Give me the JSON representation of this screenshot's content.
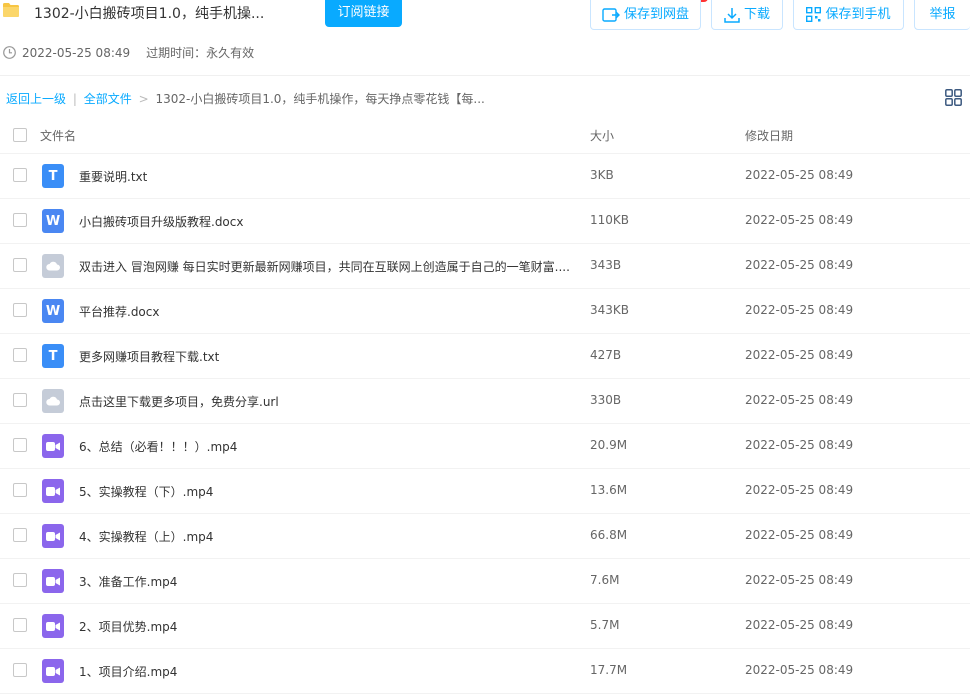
{
  "header": {
    "title": "1302-小白搬砖项目1.0，纯手机操...",
    "subscribe_label": "订阅链接",
    "save_cloud_label": "保存到网盘",
    "download_label": "下载",
    "save_phone_label": "保存到手机",
    "report_label": "举报",
    "accent_color": "#09aaff"
  },
  "meta": {
    "share_time": "2022-05-25 08:49",
    "expire_text": "过期时间：永久有效"
  },
  "breadcrumb": {
    "back": "返回上一级",
    "divider": "|",
    "all_files": "全部文件",
    "separator": ">",
    "current": "1302-小白搬砖项目1.0，纯手机操作，每天挣点零花钱【每..."
  },
  "columns": {
    "name": "文件名",
    "size": "大小",
    "date": "修改日期"
  },
  "files": [
    {
      "name": "重要说明.txt",
      "size": "3KB",
      "date": "2022-05-25 08:49",
      "type": "txt",
      "icon_letter": "T",
      "icon": "txt-file-icon"
    },
    {
      "name": "小白搬砖项目升级版教程.docx",
      "size": "110KB",
      "date": "2022-05-25 08:49",
      "type": "doc",
      "icon_letter": "W",
      "icon": "word-file-icon"
    },
    {
      "name": "双击进入 冒泡网赚 每日实时更新最新网赚项目，共同在互联网上创造属于自己的一笔财富....",
      "size": "343B",
      "date": "2022-05-25 08:49",
      "type": "other",
      "icon_letter": "",
      "icon": "cloud-file-icon"
    },
    {
      "name": "平台推荐.docx",
      "size": "343KB",
      "date": "2022-05-25 08:49",
      "type": "doc",
      "icon_letter": "W",
      "icon": "word-file-icon"
    },
    {
      "name": "更多网赚项目教程下载.txt",
      "size": "427B",
      "date": "2022-05-25 08:49",
      "type": "txt",
      "icon_letter": "T",
      "icon": "txt-file-icon"
    },
    {
      "name": "点击这里下载更多项目，免费分享.url",
      "size": "330B",
      "date": "2022-05-25 08:49",
      "type": "other",
      "icon_letter": "",
      "icon": "cloud-file-icon"
    },
    {
      "name": "6、总结（必看！！！）.mp4",
      "size": "20.9M",
      "date": "2022-05-25 08:49",
      "type": "video",
      "icon_letter": "",
      "icon": "video-file-icon"
    },
    {
      "name": "5、实操教程（下）.mp4",
      "size": "13.6M",
      "date": "2022-05-25 08:49",
      "type": "video",
      "icon_letter": "",
      "icon": "video-file-icon"
    },
    {
      "name": "4、实操教程（上）.mp4",
      "size": "66.8M",
      "date": "2022-05-25 08:49",
      "type": "video",
      "icon_letter": "",
      "icon": "video-file-icon"
    },
    {
      "name": "3、准备工作.mp4",
      "size": "7.6M",
      "date": "2022-05-25 08:49",
      "type": "video",
      "icon_letter": "",
      "icon": "video-file-icon"
    },
    {
      "name": "2、项目优势.mp4",
      "size": "5.7M",
      "date": "2022-05-25 08:49",
      "type": "video",
      "icon_letter": "",
      "icon": "video-file-icon"
    },
    {
      "name": "1、项目介绍.mp4",
      "size": "17.7M",
      "date": "2022-05-25 08:49",
      "type": "video",
      "icon_letter": "",
      "icon": "video-file-icon"
    }
  ]
}
